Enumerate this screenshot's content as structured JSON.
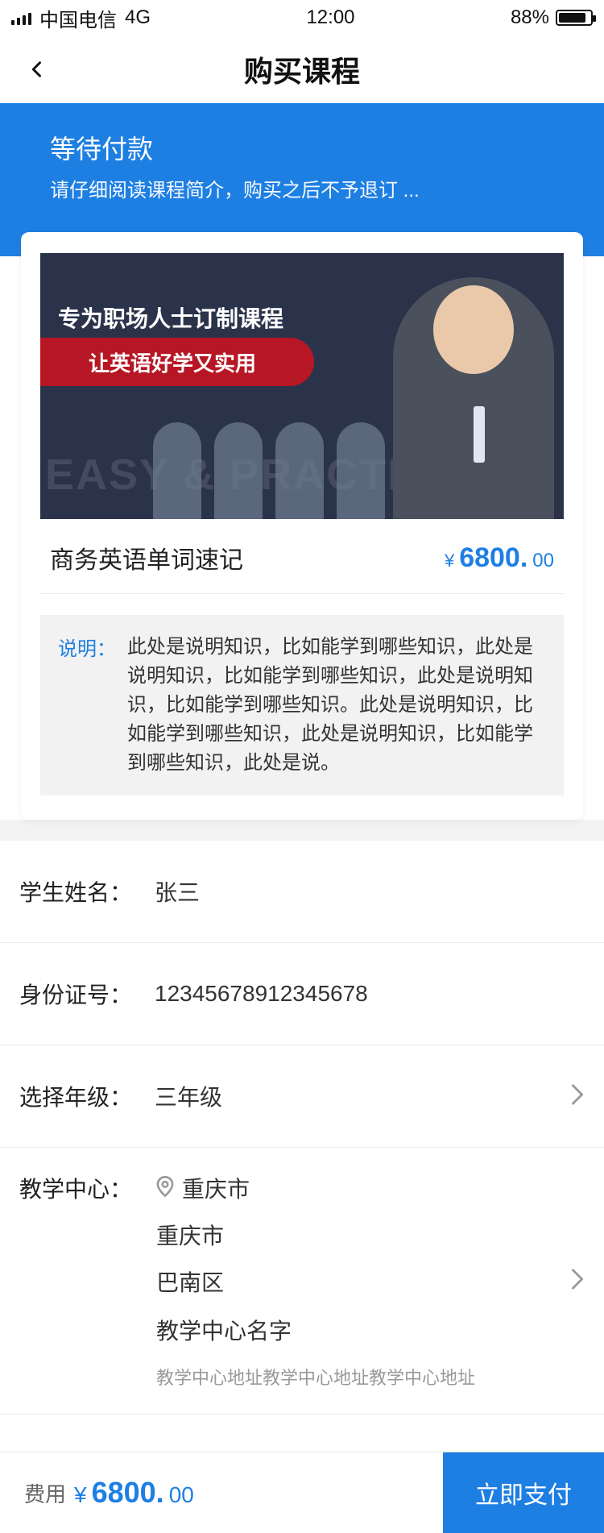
{
  "status_bar": {
    "carrier": "中国电信",
    "network": "4G",
    "time": "12:00",
    "battery": "88%",
    "battery_level": 0.88
  },
  "header": {
    "title": "购买课程",
    "back_icon": "chevron-left-icon"
  },
  "banner": {
    "status_title": "等待付款",
    "status_desc": "请仔细阅读课程简介，购买之后不予退订 ..."
  },
  "course": {
    "image": {
      "headline": "专为职场人士订制课程",
      "ribbon": "让英语好学又实用",
      "ghost": "EASY & PRACTICAL"
    },
    "name": "商务英语单词速记",
    "price": {
      "currency": "¥",
      "integer": "6800.",
      "decimal": "00"
    },
    "description_label": "说明：",
    "description": "此处是说明知识，比如能学到哪些知识，此处是说明知识，比如能学到哪些知识，此处是说明知识，比如能学到哪些知识。此处是说明知识，比如能学到哪些知识，此处是说明知识，比如能学到哪些知识，此处是说。"
  },
  "form": {
    "student_name": {
      "label": "学生姓名：",
      "value": "张三"
    },
    "id_number": {
      "label": "身份证号：",
      "value": "12345678912345678"
    },
    "grade": {
      "label": "选择年级：",
      "value": "三年级"
    },
    "center": {
      "label": "教学中心：",
      "province": "重庆市",
      "city": "重庆市",
      "district": "巴南区",
      "name": "教学中心名字",
      "address": "教学中心地址教学中心地址教学中心地址"
    }
  },
  "footer": {
    "fee_label": "费用",
    "amount": {
      "currency": "¥",
      "integer": "6800.",
      "decimal": "00"
    },
    "pay_label": "立即支付"
  },
  "colors": {
    "primary": "#1e7fe3"
  }
}
